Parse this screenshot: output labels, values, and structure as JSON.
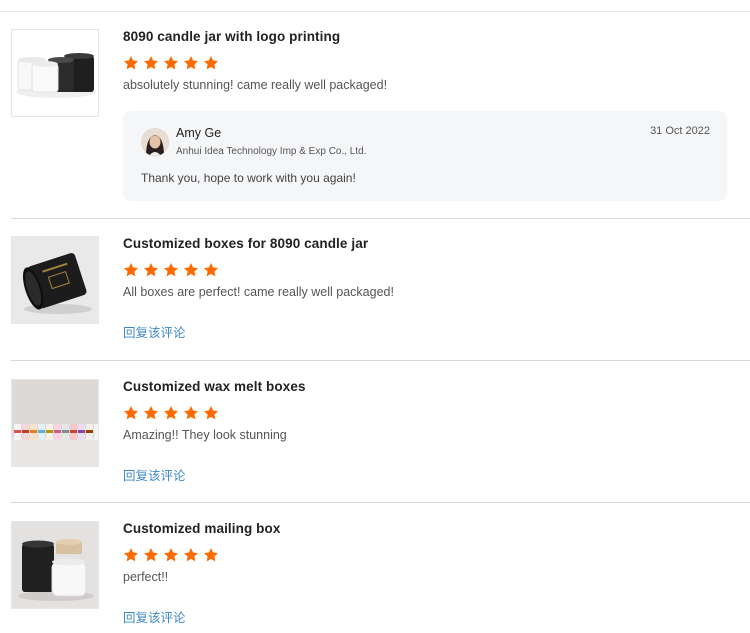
{
  "reviews": [
    {
      "title": "8090 candle jar with logo printing",
      "rating": 5,
      "text": "absolutely stunning! came really well packaged!",
      "thumbnail": "white-and-black-candle-jars-image",
      "reply": {
        "name": "Amy Ge",
        "company": "Anhui Idea Technology Imp & Exp Co., Ltd.",
        "date": "31 Oct 2022",
        "text": "Thank you, hope to work with you again!"
      }
    },
    {
      "title": "Customized boxes for 8090 candle jar",
      "rating": 5,
      "text": "All boxes are perfect! came really well packaged!",
      "thumbnail": "black-cylinder-box-image",
      "reply_link": "回复该评论"
    },
    {
      "title": "Customized wax melt boxes",
      "rating": 5,
      "text": "Amazing!! They look stunning",
      "thumbnail": "colorful-wax-melt-boxes-image",
      "reply_link": "回复该评论"
    },
    {
      "title": "Customized mailing box",
      "rating": 5,
      "text": "perfect!!",
      "thumbnail": "black-and-white-jars-image",
      "reply_link": "回复该评论"
    }
  ],
  "colors": {
    "star": "#ff6a00",
    "link": "#3e88c9",
    "reply_bg": "#f5f6f8",
    "divider": "#d9d9d9"
  }
}
